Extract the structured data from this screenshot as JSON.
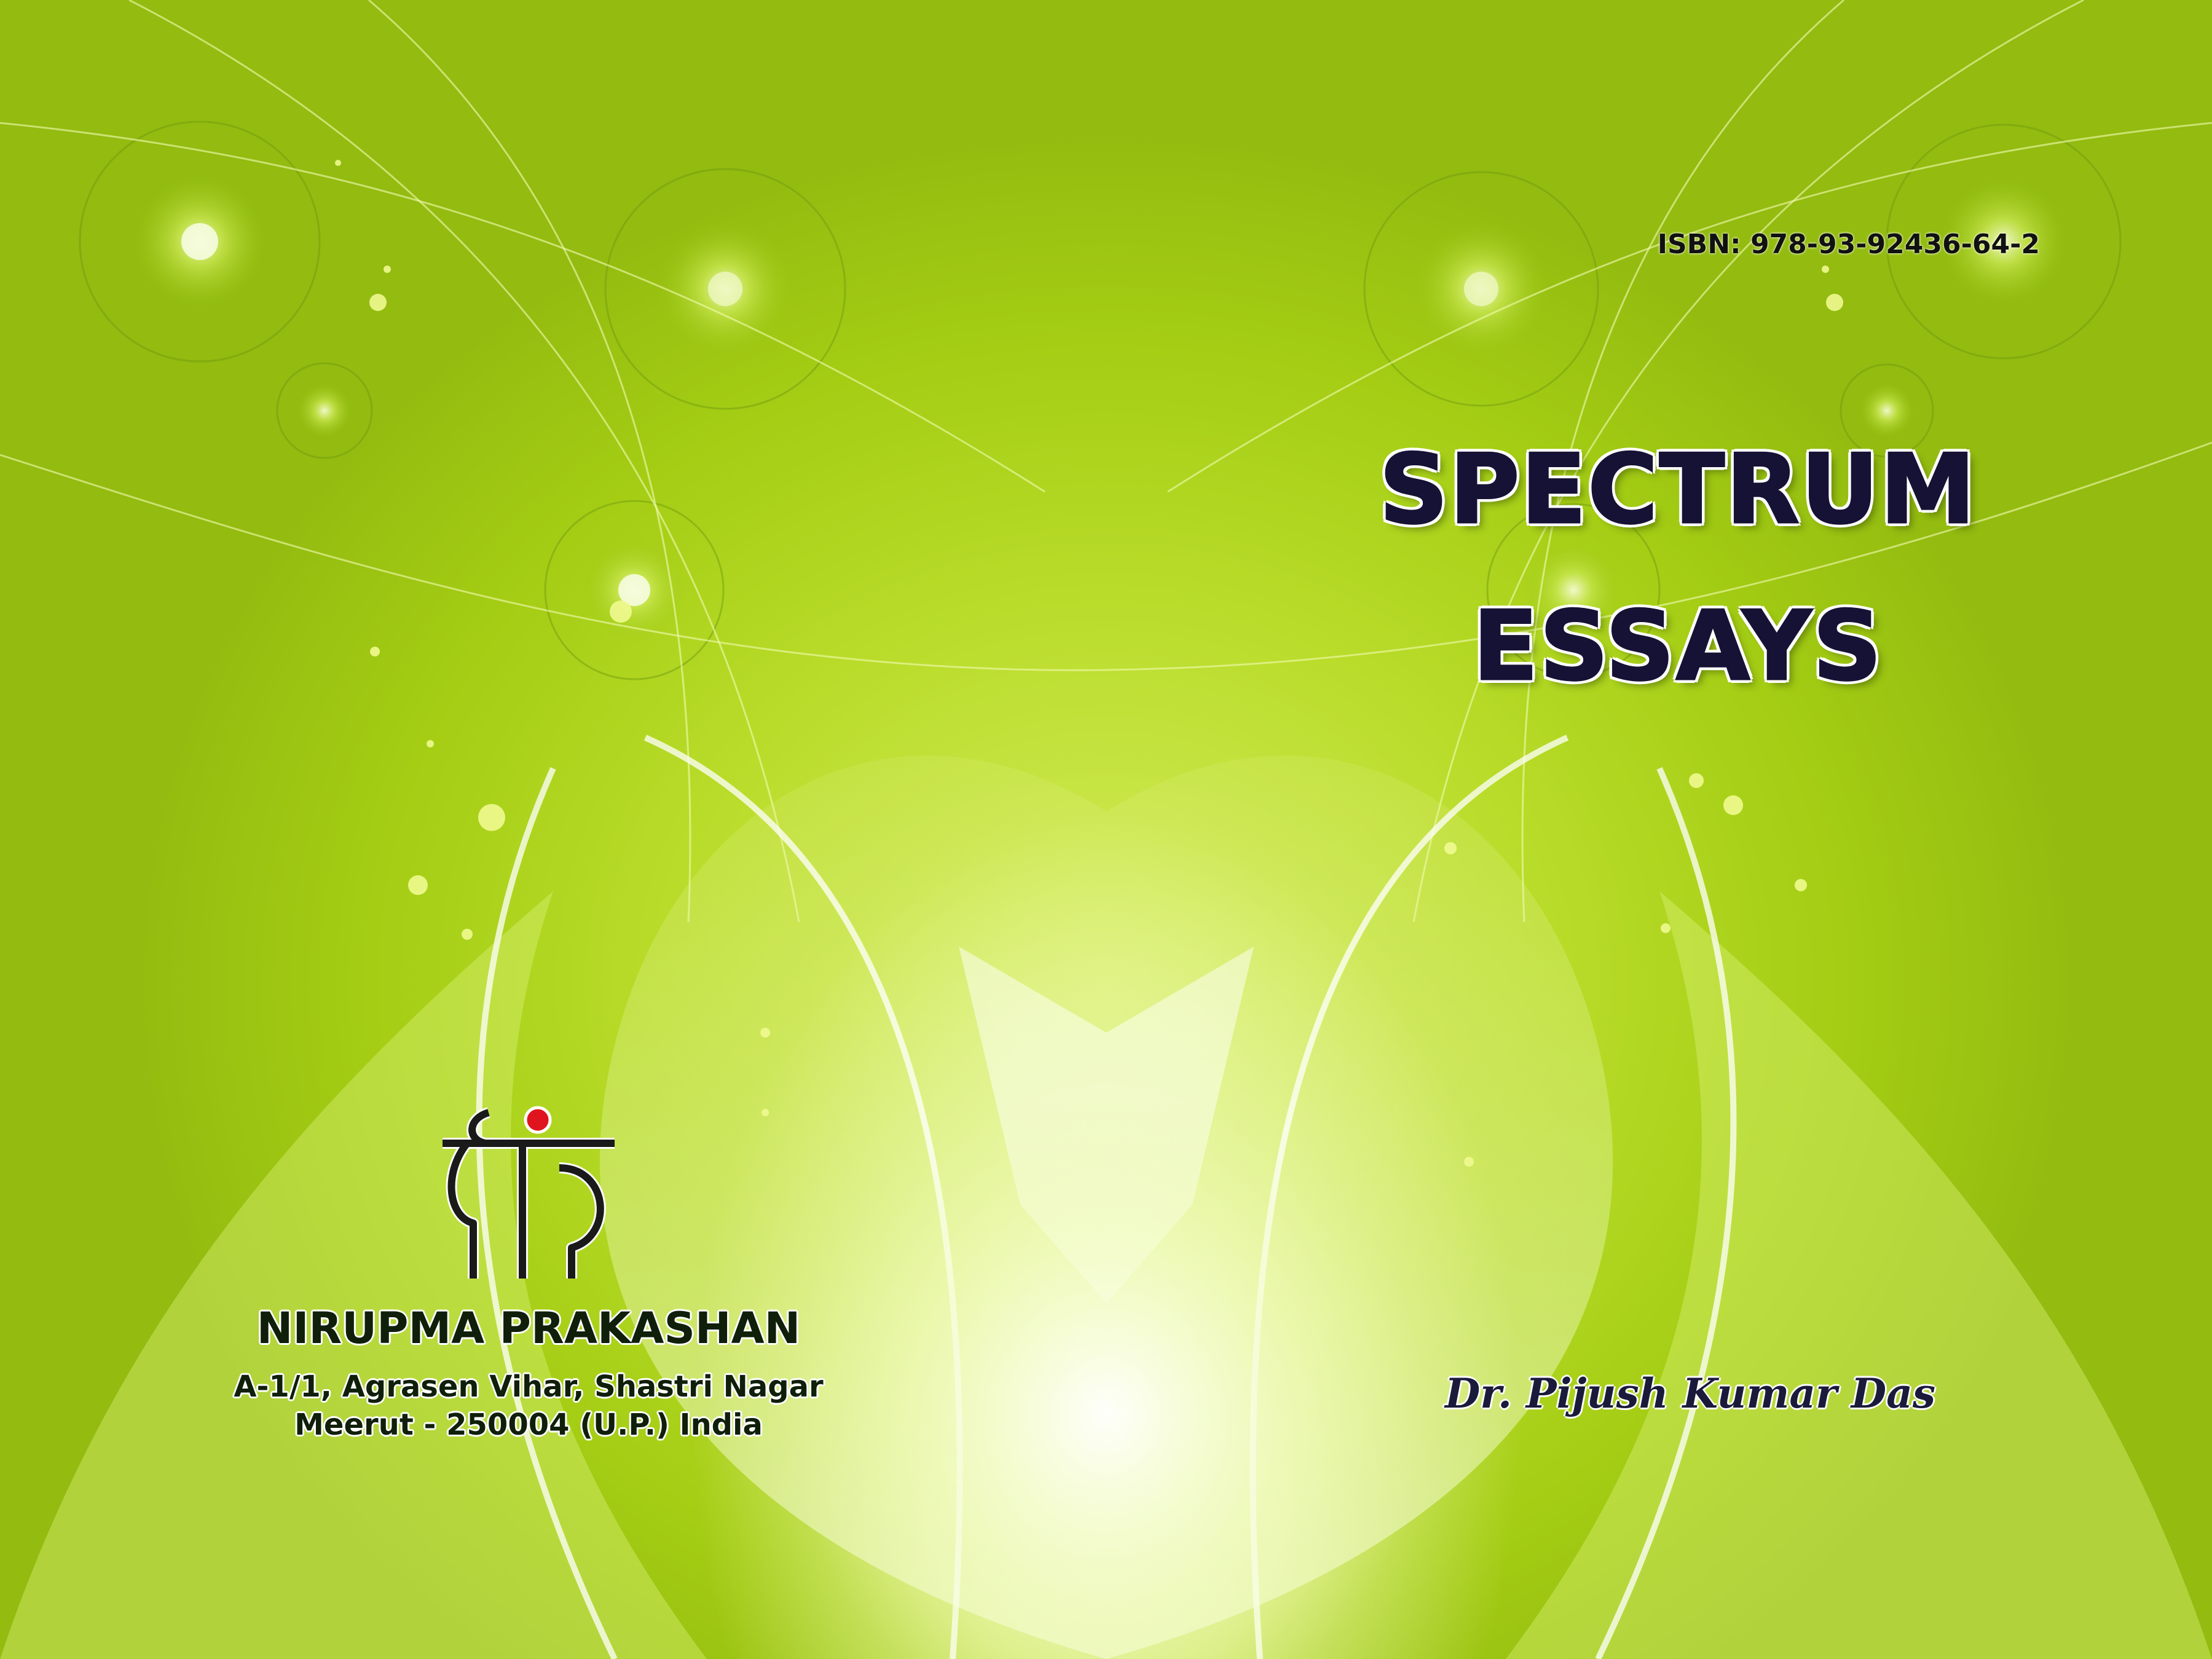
{
  "cover": {
    "isbn": "ISBN: 978-93-92436-64-2",
    "title_line1": "SPECTRUM",
    "title_line2": "ESSAYS",
    "author": "Dr. Pijush Kumar Das",
    "publisher": {
      "name": "NIRUPMA PRAKASHAN",
      "address_line1": "A-1/1, Agrasen Vihar, Shastri Nagar",
      "address_line2": "Meerut - 250004 (U.P.) India",
      "logo_text": "निप्र"
    }
  },
  "colors": {
    "background_green": "#a4d018",
    "title_ink": "#161235",
    "logo_dot": "#e0141e"
  },
  "icons": {
    "publisher_logo": "publisher-logo-mark"
  }
}
